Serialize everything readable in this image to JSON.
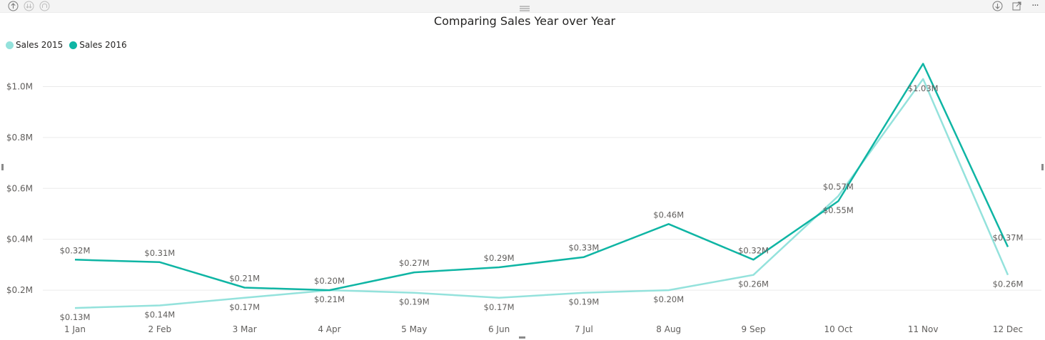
{
  "visual": {
    "title": "Comparing Sales Year over Year",
    "header_icons": {
      "left": [
        "drill-up-icon",
        "expand-level-icon",
        "drill-down-all-icon"
      ],
      "right": [
        "drill-mode-icon",
        "focus-mode-icon",
        "more-options-icon"
      ]
    },
    "more_label": "···"
  },
  "legend": {
    "items": [
      {
        "label": "Sales 2015",
        "color": "#94e2dc"
      },
      {
        "label": "Sales 2016",
        "color": "#0fb5a4"
      }
    ]
  },
  "chart_data": {
    "type": "line",
    "title": "Comparing Sales Year over Year",
    "xlabel": "",
    "ylabel": "",
    "categories": [
      "1 Jan",
      "2 Feb",
      "3 Mar",
      "4 Apr",
      "5 May",
      "6 Jun",
      "7 Jul",
      "8 Aug",
      "9 Sep",
      "10 Oct",
      "11 Nov",
      "12 Dec"
    ],
    "y_ticks": [
      "$0.2M",
      "$0.4M",
      "$0.6M",
      "$0.8M",
      "$1.0M"
    ],
    "y_tick_values": [
      0.2,
      0.4,
      0.6,
      0.8,
      1.0
    ],
    "ylim": [
      0.0,
      1.1
    ],
    "grid": true,
    "legend_position": "top-left",
    "series": [
      {
        "name": "Sales 2015",
        "color": "#94e2dc",
        "values": [
          0.13,
          0.14,
          0.17,
          0.2,
          0.19,
          0.17,
          0.19,
          0.2,
          0.26,
          0.57,
          1.03,
          0.26
        ],
        "labels": [
          "$0.13M",
          "$0.14M",
          "$0.17M",
          "$0.21M",
          "$0.19M",
          "$0.17M",
          "$0.19M",
          "$0.20M",
          "$0.26M",
          "$0.57M",
          "$1.03M",
          "$0.26M"
        ]
      },
      {
        "name": "Sales 2016",
        "color": "#0fb5a4",
        "values": [
          0.32,
          0.31,
          0.21,
          0.2,
          0.27,
          0.29,
          0.33,
          0.46,
          0.32,
          0.55,
          1.09,
          0.37
        ],
        "labels": [
          "$0.32M",
          "$0.31M",
          "$0.21M",
          "$0.20M",
          "$0.27M",
          "$0.29M",
          "$0.33M",
          "$0.46M",
          "$0.32M",
          "$0.55M",
          "",
          "$0.37M"
        ]
      }
    ]
  }
}
